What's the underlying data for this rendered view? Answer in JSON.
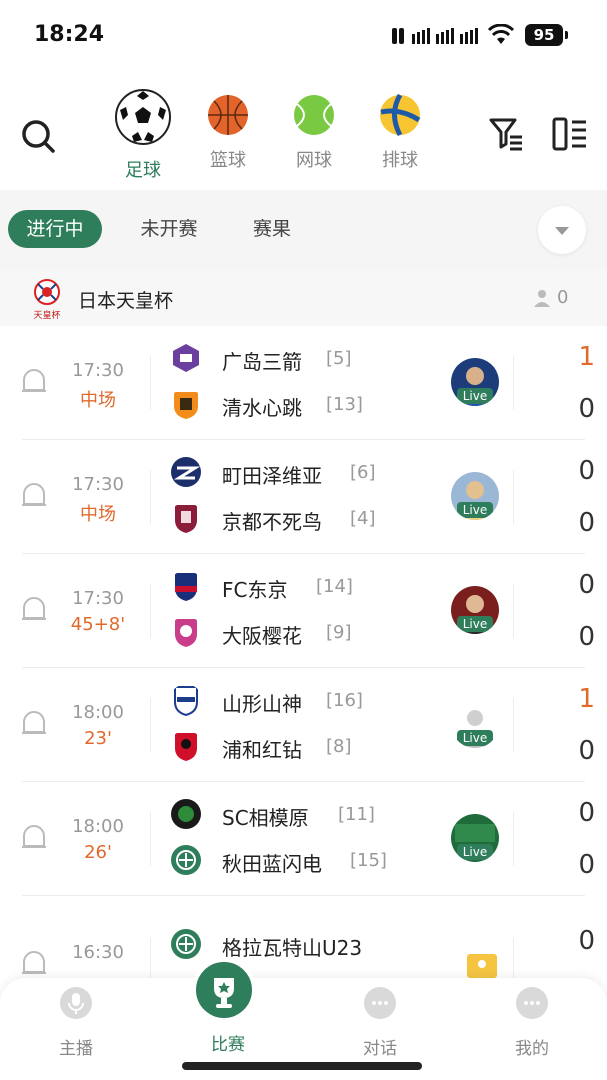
{
  "status_bar": {
    "time": "18:24",
    "battery": "95"
  },
  "sports": [
    {
      "label": "足球",
      "icon": "soccer-ball-icon",
      "active": true
    },
    {
      "label": "篮球",
      "icon": "basketball-icon",
      "active": false
    },
    {
      "label": "网球",
      "icon": "tennis-ball-icon",
      "active": false
    },
    {
      "label": "排球",
      "icon": "volleyball-icon",
      "active": false
    }
  ],
  "tabs": [
    {
      "label": "进行中",
      "active": true
    },
    {
      "label": "未开赛",
      "active": false
    },
    {
      "label": "赛果",
      "active": false
    }
  ],
  "league": {
    "name": "日本天皇杯",
    "logo_text": "天皇杯",
    "followers": "0"
  },
  "matches": [
    {
      "time": "17:30",
      "status": "中场",
      "home": "广岛三箭",
      "home_rank": "[5]",
      "away": "清水心跳",
      "away_rank": "[13]",
      "home_score": "1",
      "away_score": "0",
      "home_score_highlight": true,
      "live": "Live"
    },
    {
      "time": "17:30",
      "status": "中场",
      "home": "町田泽维亚",
      "home_rank": "[6]",
      "away": "京都不死鸟",
      "away_rank": "[4]",
      "home_score": "0",
      "away_score": "0",
      "home_score_highlight": false,
      "live": "Live"
    },
    {
      "time": "17:30",
      "status": "45+8'",
      "home": "FC东京",
      "home_rank": "[14]",
      "away": "大阪樱花",
      "away_rank": "[9]",
      "home_score": "0",
      "away_score": "0",
      "home_score_highlight": false,
      "live": "Live"
    },
    {
      "time": "18:00",
      "status": "23'",
      "home": "山形山神",
      "home_rank": "[16]",
      "away": "浦和红钻",
      "away_rank": "[8]",
      "home_score": "1",
      "away_score": "0",
      "home_score_highlight": true,
      "live": "Live"
    },
    {
      "time": "18:00",
      "status": "26'",
      "home": "SC相模原",
      "home_rank": "[11]",
      "away": "秋田蓝闪电",
      "away_rank": "[15]",
      "home_score": "0",
      "away_score": "0",
      "home_score_highlight": false,
      "live": "Live"
    },
    {
      "time": "16:30",
      "status": "",
      "home": "格拉瓦特山U23",
      "home_rank": "",
      "away": "",
      "away_rank": "",
      "home_score": "0",
      "away_score": "",
      "home_score_highlight": false,
      "live": ""
    }
  ],
  "bottom_nav": [
    {
      "label": "主播",
      "icon": "microphone-icon",
      "active": false
    },
    {
      "label": "比赛",
      "icon": "trophy-icon",
      "active": true
    },
    {
      "label": "对话",
      "icon": "chat-icon",
      "active": false
    },
    {
      "label": "我的",
      "icon": "profile-icon",
      "active": false
    }
  ],
  "colors": {
    "accent": "#2e7d5b",
    "live_minute": "#e06a2c",
    "score_highlight": "#e06a2c"
  }
}
